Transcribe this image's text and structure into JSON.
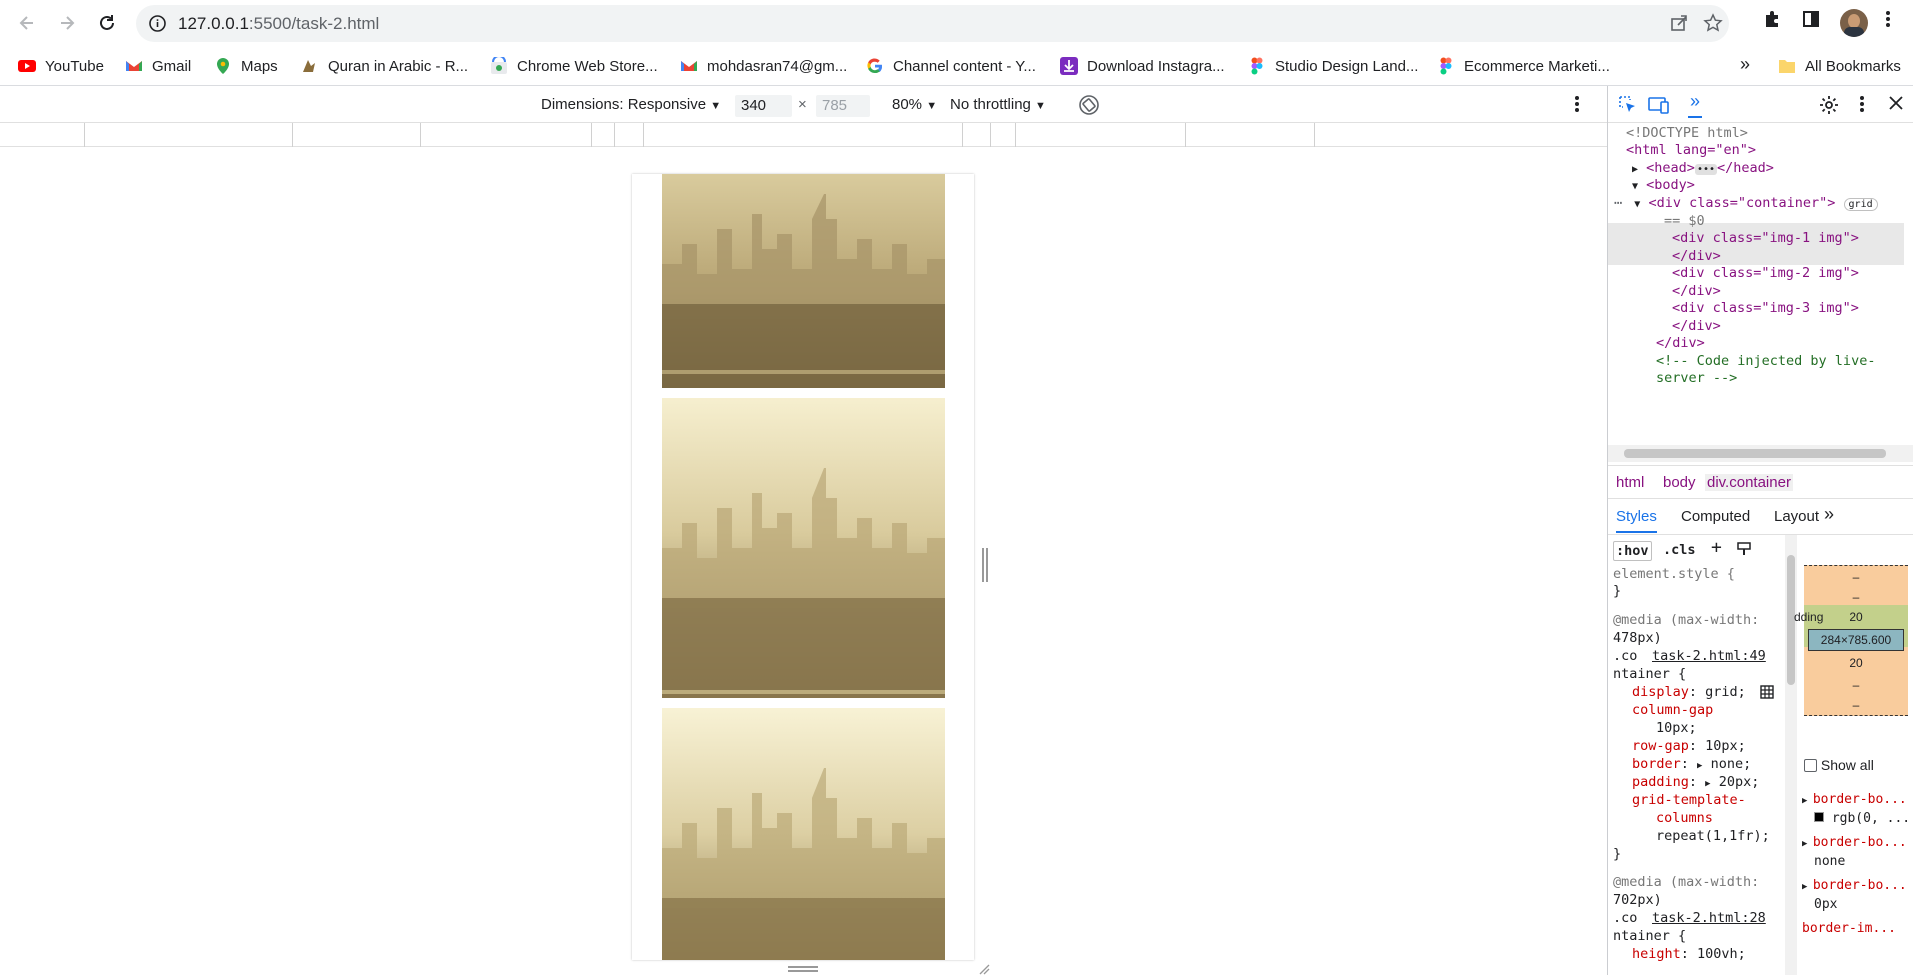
{
  "browser": {
    "url_host": "127.0.0.1",
    "url_path": ":5500/task-2.html"
  },
  "bookmarks": [
    {
      "label": "YouTube",
      "icon": "youtube-icon"
    },
    {
      "label": "Gmail",
      "icon": "gmail-icon"
    },
    {
      "label": "Maps",
      "icon": "maps-icon"
    },
    {
      "label": "Quran in Arabic - R...",
      "icon": "quran-icon"
    },
    {
      "label": "Chrome Web Store...",
      "icon": "chrome-web-store-icon"
    },
    {
      "label": "mohdasran74@gm...",
      "icon": "gmail-icon"
    },
    {
      "label": "Channel content - Y...",
      "icon": "google-icon"
    },
    {
      "label": "Download Instagra...",
      "icon": "download-icon"
    },
    {
      "label": "Studio Design Land...",
      "icon": "figma-icon"
    },
    {
      "label": "Ecommerce Marketi...",
      "icon": "figma-icon"
    }
  ],
  "bookmarks_more": "»",
  "all_bookmarks": "All Bookmarks",
  "emulation": {
    "dimensions_label": "Dimensions: Responsive",
    "width": "340",
    "times": "×",
    "height": "785",
    "zoom": "80%",
    "throttling": "No throttling"
  },
  "devtools": {
    "elements": [
      {
        "text": "<!DOCTYPE html>"
      },
      {
        "text": "<html lang=\"en\">"
      },
      {
        "text": "<head>"
      },
      {
        "text": "</head>"
      },
      {
        "text": "<body>"
      },
      {
        "text": "<div class=\"container\">"
      },
      {
        "text": "grid"
      },
      {
        "text": "== $0"
      },
      {
        "text": "<div class=\"img-1 img\">"
      },
      {
        "text": "</div>"
      },
      {
        "text": "<div class=\"img-2 img\">"
      },
      {
        "text": "</div>"
      },
      {
        "text": "<div class=\"img-3 img\">"
      },
      {
        "text": "</div>"
      },
      {
        "text": "</div>"
      },
      {
        "text": "<!-- Code injected by live-"
      },
      {
        "text": "server -->"
      }
    ],
    "breadcrumbs": [
      "html",
      "body",
      "div.container"
    ],
    "tabs": [
      "Styles",
      "Computed",
      "Layout"
    ],
    "filter": {
      "hov": ":hov",
      "cls": ".cls"
    },
    "styles": {
      "element_style": "element.style {",
      "close": "}",
      "media1": "@media (max-width:",
      "media1b": "478px)",
      "sel1a": ".co",
      "file1": "task-2.html:49",
      "sel1b": "ntainer {",
      "p1": "display",
      "v1": "grid;",
      "p2": "column-gap",
      "v2": "10px;",
      "p3": "row-gap",
      "v3": "10px;",
      "p4": "border",
      "v4": "none;",
      "p5": "padding",
      "v5": "20px;",
      "p6": "grid-template-",
      "p6b": "columns",
      "v6": "repeat(1,1fr);",
      "media2": "@media (max-width:",
      "media2b": "702px)",
      "sel2a": ".co",
      "file2": "task-2.html:28",
      "sel2b": "ntainer {",
      "p7": "height",
      "v7": "100vh;"
    },
    "boxmodel": {
      "dash1": "–",
      "dash2": "–",
      "padding_label": "dding",
      "padding_top": "20",
      "content": "284×785.600",
      "padding_bottom": "20",
      "dash3": "–",
      "dash4": "–"
    },
    "computed": {
      "show_all": "Show all",
      "r1": "border-bo...",
      "r1v": "rgb(0, ...",
      "r2": "border-bo...",
      "r2v": "none",
      "r3": "border-bo...",
      "r3v": "0px",
      "r4": "border-im..."
    }
  }
}
